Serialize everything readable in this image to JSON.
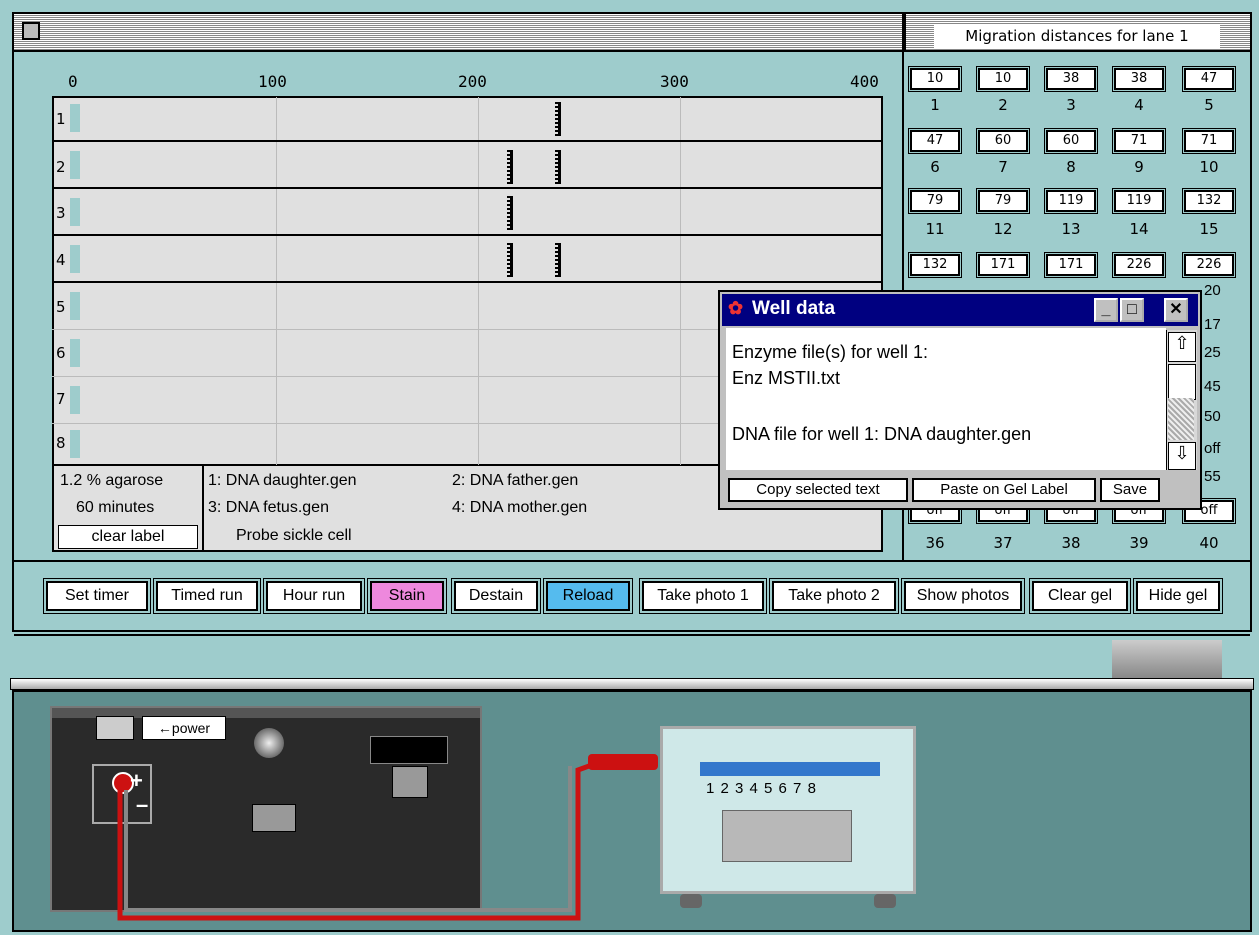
{
  "window": {
    "title_right": "Migration distances for lane 1"
  },
  "axis": {
    "ticks": [
      "0",
      "100",
      "200",
      "300",
      "400"
    ]
  },
  "lanes": [
    "1",
    "2",
    "3",
    "4",
    "5",
    "6",
    "7",
    "8"
  ],
  "gel_info": {
    "agarose": "1.2 % agarose",
    "minutes": "60 minutes",
    "clear_label": "clear label",
    "samples": [
      "1:  DNA daughter.gen",
      "2:  DNA father.gen",
      "3:  DNA fetus.gen",
      "4:  DNA mother.gen"
    ],
    "probe": "Probe sickle cell"
  },
  "migration": {
    "values": [
      "10",
      "10",
      "38",
      "38",
      "47",
      "47",
      "60",
      "60",
      "71",
      "71",
      "79",
      "79",
      "119",
      "119",
      "132",
      "132",
      "171",
      "171",
      "226",
      "226"
    ],
    "labels": [
      "1",
      "2",
      "3",
      "4",
      "5",
      "6",
      "7",
      "8",
      "9",
      "10",
      "11",
      "12",
      "13",
      "14",
      "15"
    ],
    "partial_right": [
      "20",
      "17",
      "25",
      "45",
      "50",
      "off",
      "55"
    ],
    "bottom_values": [
      "off",
      "off",
      "off",
      "off",
      "off"
    ],
    "bottom_labels": [
      "36",
      "37",
      "38",
      "39",
      "40"
    ]
  },
  "toolbar": {
    "set_timer": "Set timer",
    "timed_run": "Timed run",
    "hour_run": "Hour run",
    "stain": "Stain",
    "destain": "Destain",
    "reload": "Reload",
    "take_photo_1": "Take photo 1",
    "take_photo_2": "Take photo 2",
    "show_photos": "Show photos",
    "clear_gel": "Clear gel",
    "hide_gel": "Hide gel"
  },
  "dialog": {
    "title": "Well data",
    "line1": "Enzyme file(s) for well 1:",
    "line2": "Enz MSTII.txt",
    "line3": "DNA file for well 1:  DNA daughter.gen",
    "copy": "Copy selected text",
    "paste": "Paste on Gel Label",
    "save": "Save"
  },
  "apparatus": {
    "power_label": "←power",
    "well_numbers": "1 2 3 4 5 6 7 8"
  },
  "colors": {
    "stain": "#ee88dd",
    "reload": "#55bbee",
    "bg": "#9ecccc"
  }
}
